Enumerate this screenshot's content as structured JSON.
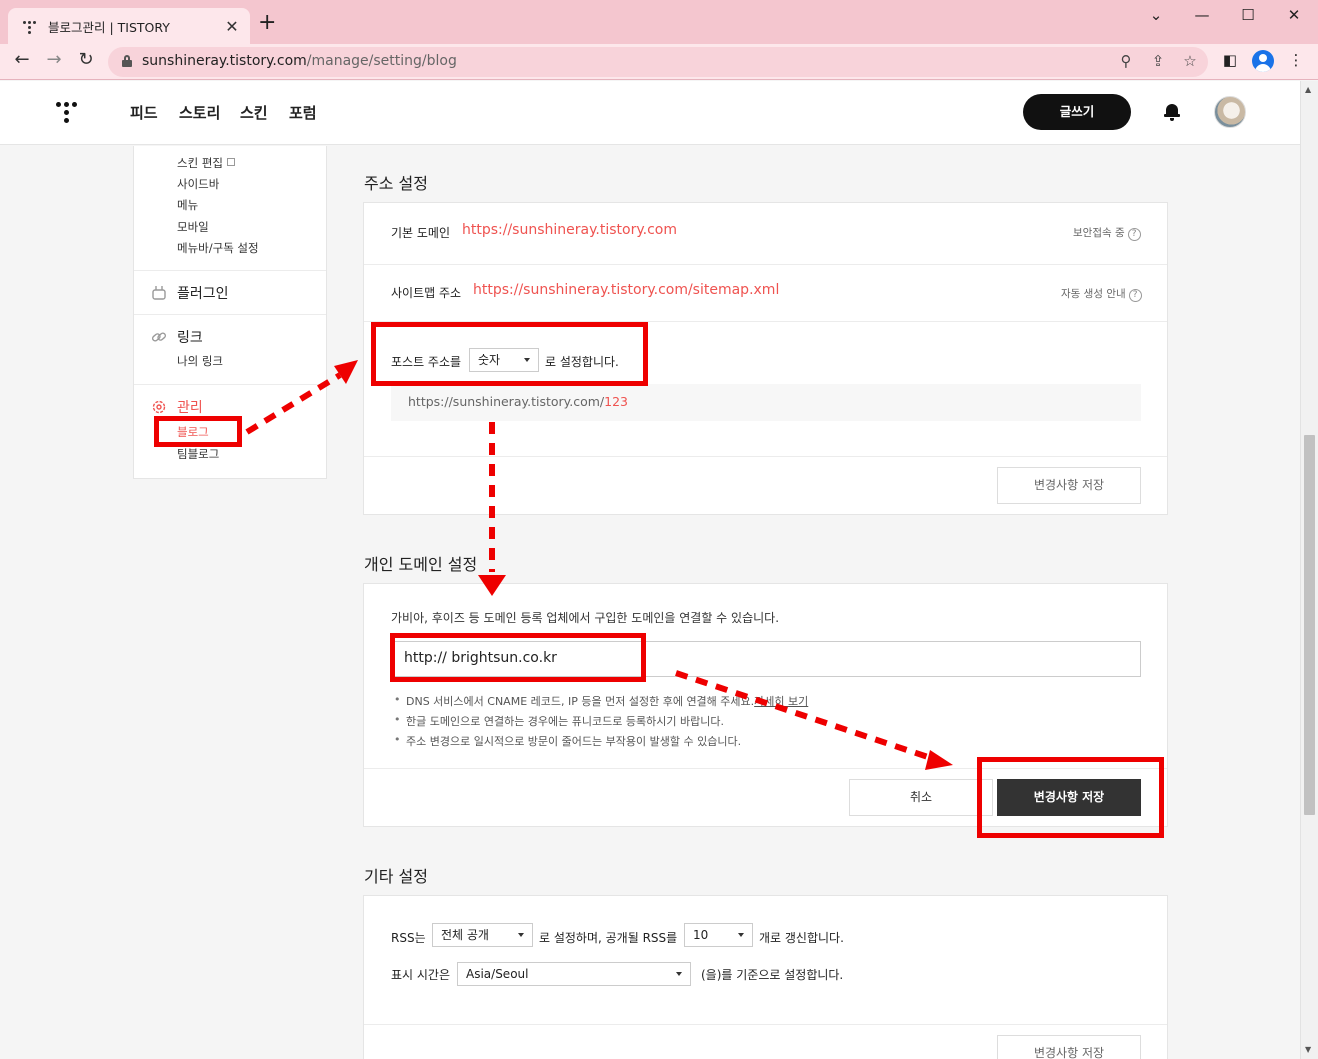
{
  "browser": {
    "tab_title": "블로그관리 | TISTORY",
    "url_host": "sunshineray.tistory.com",
    "url_path": "/manage/setting/blog"
  },
  "header": {
    "nav": [
      "피드",
      "스토리",
      "스킨",
      "포럼"
    ],
    "write_label": "글쓰기"
  },
  "sidebar": {
    "skin_items": [
      "스킨 편집",
      "사이드바",
      "메뉴",
      "모바일",
      "메뉴바/구독 설정"
    ],
    "plugin_label": "플러그인",
    "link_label": "링크",
    "my_link_label": "나의 링크",
    "manage_label": "관리",
    "blog_label": "블로그",
    "team_blog_label": "팀블로그"
  },
  "address_section": {
    "title": "주소 설정",
    "default_domain_label": "기본 도메인",
    "default_domain_url": "https://sunshineray.tistory.com",
    "secure_label": "보안접속 중",
    "sitemap_label": "사이트맵 주소",
    "sitemap_url": "https://sunshineray.tistory.com/sitemap.xml",
    "sitemap_info_label": "자동 생성 안내",
    "post_addr_prefix": "포스트 주소를",
    "post_addr_option": "숫자",
    "post_addr_suffix": "로 설정합니다.",
    "example_base": "https://sunshineray.tistory.com/",
    "example_num": "123",
    "save_label": "변경사항 저장"
  },
  "domain_section": {
    "title": "개인 도메인 설정",
    "description": "가비아, 후이즈 등 도메인 등록 업체에서 구입한 도메인을 연결할 수 있습니다.",
    "input_value": "http:// brightsun.co.kr",
    "bullet1": "DNS 서비스에서 CNAME 레코드, IP 등을 먼저 설정한 후에 연결해 주세요.",
    "bullet1_link": "자세히 보기",
    "bullet2": "한글 도메인으로 연결하는 경우에는 퓨니코드로 등록하시기 바랍니다.",
    "bullet3": "주소 변경으로 일시적으로 방문이 줄어드는 부작용이 발생할 수 있습니다.",
    "cancel_label": "취소",
    "save_label": "변경사항 저장"
  },
  "other_section": {
    "title": "기타 설정",
    "rss_prefix": "RSS는",
    "rss_option": "전체 공개",
    "rss_middle": "로 설정하며, 공개될 RSS를",
    "rss_count": "10",
    "rss_suffix": "개로 갱신합니다.",
    "tz_prefix": "표시 시간은",
    "tz_option": "Asia/Seoul",
    "tz_suffix": "(을)를 기준으로 설정합니다.",
    "save_label": "변경사항 저장"
  },
  "colors": {
    "accent_red": "#ef5350",
    "annotation_red": "#ee0000",
    "tab_bar": "#f4c6cf"
  }
}
